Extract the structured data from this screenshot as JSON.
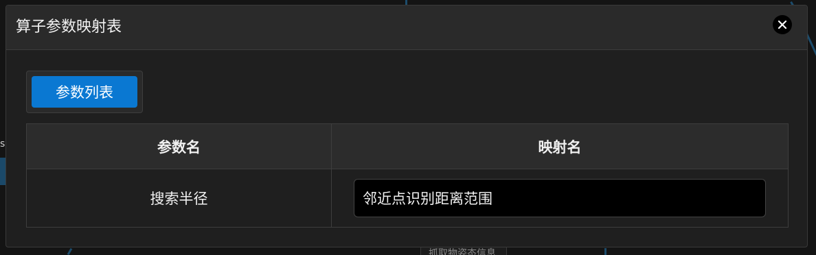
{
  "background": {
    "partial_label": "抓取物姿态信息",
    "left_edge_text": "s"
  },
  "dialog": {
    "title": "算子参数映射表",
    "close_icon": "close-icon"
  },
  "tabs": [
    {
      "label": "参数列表",
      "active": true
    }
  ],
  "table": {
    "headers": [
      "参数名",
      "映射名"
    ],
    "rows": [
      {
        "param_name": "搜索半径",
        "mapping_name": "邻近点识别距离范围"
      }
    ]
  },
  "colors": {
    "accent": "#0a78d2",
    "dialog_bg": "#1f1f1f",
    "header_bg": "#2a2a2a",
    "input_bg": "#000000"
  }
}
